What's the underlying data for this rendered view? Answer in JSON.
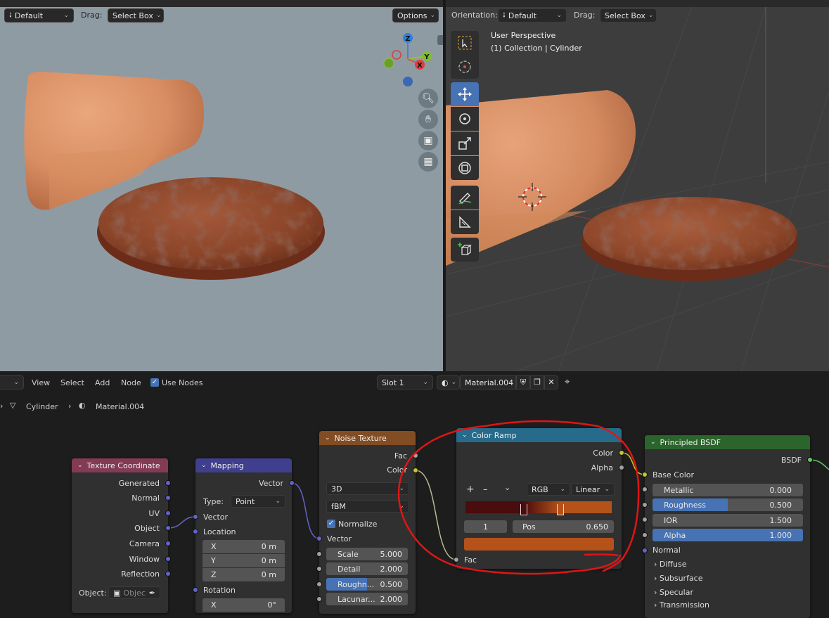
{
  "left_viewport": {
    "header": {
      "orientation_value": "Default",
      "drag_label": "Drag:",
      "drag_value": "Select Box",
      "options_label": "Options"
    },
    "gizmo": {
      "z": "Z",
      "y": "Y",
      "x": "X"
    }
  },
  "right_viewport": {
    "header": {
      "orientation_label": "Orientation:",
      "orientation_value": "Default",
      "drag_label": "Drag:",
      "drag_value": "Select Box"
    },
    "overlay_title": "User Perspective",
    "overlay_subtitle": "(1) Collection | Cylinder"
  },
  "node_editor": {
    "menu": {
      "view": "View",
      "select": "Select",
      "add": "Add",
      "node": "Node",
      "use_nodes": "Use Nodes"
    },
    "slot": "Slot 1",
    "material_name": "Material.004",
    "breadcrumb": {
      "object": "Cylinder",
      "material": "Material.004"
    }
  },
  "nodes": {
    "texture_coordinate": {
      "title": "Texture Coordinate",
      "outputs": [
        "Generated",
        "Normal",
        "UV",
        "Object",
        "Camera",
        "Window",
        "Reflection"
      ],
      "object_label": "Object:",
      "object_placeholder": "Objec"
    },
    "mapping": {
      "title": "Mapping",
      "output": "Vector",
      "type_label": "Type:",
      "type_value": "Point",
      "vector_label": "Vector",
      "location_label": "Location",
      "x_label": "X",
      "x_value": "0 m",
      "y_label": "Y",
      "y_value": "0 m",
      "z_label": "Z",
      "z_value": "0 m",
      "rotation_label": "Rotation",
      "rx_label": "X",
      "rx_value": "0°"
    },
    "noise_texture": {
      "title": "Noise Texture",
      "out_fac": "Fac",
      "out_color": "Color",
      "dim": "3D",
      "type": "fBM",
      "normalize": "Normalize",
      "vector": "Vector",
      "scale_label": "Scale",
      "scale_value": "5.000",
      "detail_label": "Detail",
      "detail_value": "2.000",
      "roughness_label": "Roughn...",
      "roughness_value": "0.500",
      "roughness_fill": 0.5,
      "lacunarity_label": "Lacunar...",
      "lacunarity_value": "2.000"
    },
    "color_ramp": {
      "title": "Color Ramp",
      "out_color": "Color",
      "out_alpha": "Alpha",
      "add": "+",
      "remove": "–",
      "menu": "⌄",
      "color_mode": "RGB",
      "interpolation": "Linear",
      "index": "1",
      "pos_label": "Pos",
      "pos_value": "0.650",
      "input_fac": "Fac",
      "stop_positions": [
        0.4,
        0.65
      ],
      "stop_colors": [
        "#4a0c0c",
        "#b5521a"
      ],
      "preview_color": "#b5521a"
    },
    "principled_bsdf": {
      "title": "Principled BSDF",
      "output": "BSDF",
      "base_color": "Base Color",
      "metallic_label": "Metallic",
      "metallic_value": "0.000",
      "roughness_label": "Roughness",
      "roughness_value": "0.500",
      "roughness_fill": 0.5,
      "ior_label": "IOR",
      "ior_value": "1.500",
      "alpha_label": "Alpha",
      "alpha_value": "1.000",
      "alpha_fill": 1.0,
      "normal": "Normal",
      "panels": [
        "Diffuse",
        "Subsurface",
        "Specular",
        "Transmission"
      ]
    }
  },
  "colors": {
    "accent": "#4772b3",
    "texcoord_header": "#833a54",
    "mapping_header": "#3f3f8e",
    "noise_header": "#834d23",
    "ramp_header": "#276b8c",
    "bsdf_header": "#2b652b",
    "annotation": "#e01515"
  },
  "icons": [
    "orientation-icon",
    "zoom-icon",
    "hand-icon",
    "camera-icon",
    "grid-icon",
    "select-box-icon",
    "cursor-icon",
    "move-icon",
    "rotate-icon",
    "scale-icon",
    "transform-icon",
    "annotate-icon",
    "measure-icon",
    "add-cube-icon",
    "material-icon",
    "shield-icon",
    "copy-icon",
    "close-icon",
    "pin-icon",
    "mesh-icon",
    "eyedropper-icon"
  ]
}
